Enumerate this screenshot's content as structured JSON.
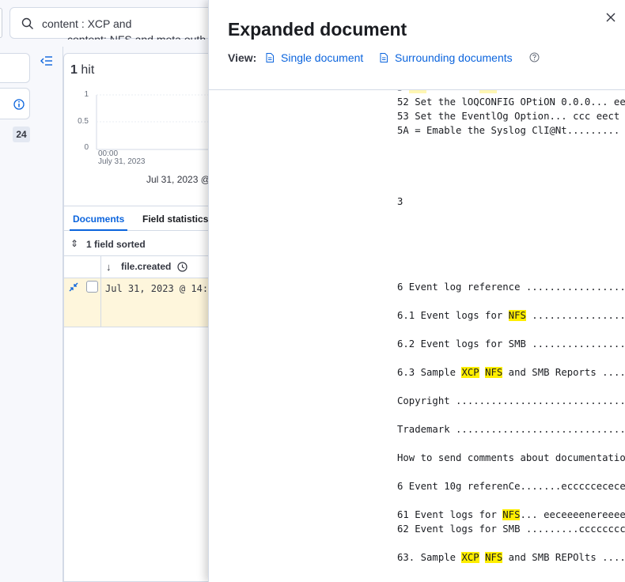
{
  "search": {
    "line1": "content : XCP and",
    "line2": "content: NFS and meta outh"
  },
  "sidebar": {
    "badge": "24"
  },
  "main": {
    "hits_count": "1",
    "hits_label": "hit",
    "chart_data": {
      "type": "bar",
      "yticks": [
        "1",
        "0.5",
        "0"
      ],
      "x_tick_time": "00:00",
      "x_tick_date": "July 31, 2023",
      "categories": [
        "Jul 31, 2023 00:00"
      ],
      "values": [
        1
      ],
      "ylim": [
        0,
        1
      ]
    },
    "time_range": "Jul 31, 2023 @",
    "tabs": [
      {
        "label": "Documents",
        "active": true
      },
      {
        "label": "Field statistics",
        "active": false
      }
    ],
    "sort_label": "1 field sorted",
    "column_header": "file.created",
    "row_value": "Jul 31, 2023 @ 14:"
  },
  "flyout": {
    "title": "Expanded document",
    "view_label": "View:",
    "link_single": "Single document",
    "link_surrounding": "Surrounding documents",
    "accent": "#0b64dd",
    "highlight_color": "#ffee00",
    "lines": [
      {
        "text": "52 Set the lOQCONFIG OPtiON 0.0.0... eee"
      },
      {
        "text": "53 Set the EventlOg Option... ccc eect e"
      },
      {
        "text": "5A = Emable the Syslog ClI@Nt......... i"
      },
      {
        "text": "3"
      },
      {
        "text": "6 Event log reference ...................."
      },
      {
        "pre": "6.1 Event logs for ",
        "hl1": "NFS",
        "post": " ................."
      },
      {
        "text": "6.2 Event logs for SMB ..................."
      },
      {
        "pre": "6.3 Sample ",
        "hl1": "XCP",
        "mid": " ",
        "hl2": "NFS",
        "post": " and SMB Reports ......"
      },
      {
        "text": "Copyright ................................"
      },
      {
        "text": "Trademark ................................"
      },
      {
        "text": "How to send comments about documentation"
      },
      {
        "text": "6 Event 10g referenCe.......ecccccececeee"
      },
      {
        "pre": "61 Event logs for ",
        "hl1": "NFS",
        "post": "... eeceeeenereeeen"
      },
      {
        "text": "62 Event logs for SMB .........ccccccccc"
      },
      {
        "pre": "63. Sample ",
        "hl1": "XCP",
        "mid": " ",
        "hl2": "NFS",
        "post": " and SMB REPOlts ....."
      }
    ]
  }
}
